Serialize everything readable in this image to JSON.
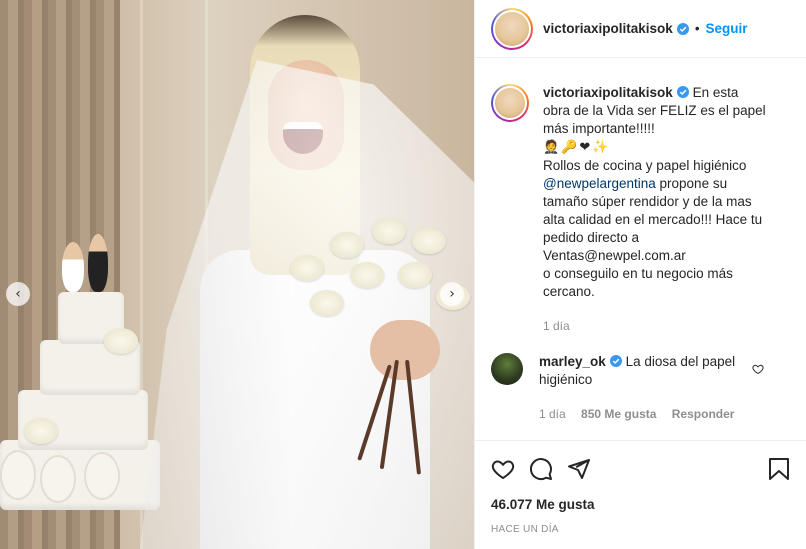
{
  "post": {
    "username": "victoriaxipolitakisok",
    "follow_label": "Seguir",
    "separator": "•"
  },
  "photo": {
    "description_alt": "",
    "nav_left_glyph": "‹",
    "nav_right_glyph": "›"
  },
  "caption": {
    "username": "victoriaxipolitakisok",
    "line1": "En esta obra de la Vida ser FELIZ es el papel más importante!!!!!",
    "emojis": "🤵🔑❤✨",
    "line2": "Rollos de cocina y papel higiénico",
    "mention": "@newpelargentina",
    "line3": " propone su tamaño súper rendidor y de la mas alta calidad en el mercado!!! Hace tu pedido directo a",
    "line4": "Ventas@newpel.com.ar",
    "line5": "o conseguilo en tu negocio más cercano.",
    "time": "1 día"
  },
  "reply": {
    "username": "marley_ok",
    "text": "La diosa del papel higiénico",
    "time": "1 día",
    "likes": "850 Me gusta",
    "reply_label": "Responder"
  },
  "actions": {
    "likes": "46.077 Me gusta",
    "date": "HACE UN DÍA"
  },
  "colors": {
    "link": "#0095f6",
    "mention": "#00376b",
    "verified": "#3897f0",
    "muted": "#8e8e8e"
  }
}
